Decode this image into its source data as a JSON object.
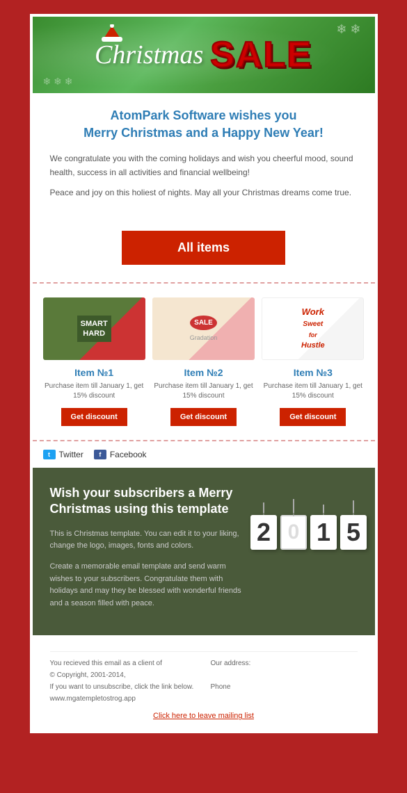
{
  "header": {
    "banner": {
      "christmas_text": "Christmas",
      "sale_text": "SALE"
    },
    "title": "AtomPark Software wishes you\nMerry Christmas and a Happy New Year!",
    "body1": "We congratulate you with the coming holidays and wish you cheerful mood, sound health, success in all activities and financial wellbeing!",
    "body2": "Peace and joy on this holiest of nights. May all your Christmas dreams come true."
  },
  "cta": {
    "button_label": "All items"
  },
  "products": {
    "items": [
      {
        "id": "1",
        "title": "Item №1",
        "description": "Purchase item till January 1, get 15% discount",
        "button_label": "Get discount",
        "img_text1": "SMART",
        "img_text2": "HARD"
      },
      {
        "id": "2",
        "title": "Item №2",
        "description": "Purchase item till January 1, get 15% discount",
        "button_label": "Get discount",
        "img_text1": "SALE",
        "img_text2": "Gradation"
      },
      {
        "id": "3",
        "title": "Item №3",
        "description": "Purchase item till January 1, get 15% discount",
        "button_label": "Get discount",
        "img_text1": "Work",
        "img_text2": "Sweet"
      }
    ]
  },
  "social": {
    "twitter_label": "Twitter",
    "facebook_label": "Facebook"
  },
  "promo": {
    "title": "Wish your subscribers a Merry Christmas using this template",
    "body1": "This is Christmas template. You can edit it to your liking, change the logo, images, fonts and colors.",
    "body2": "Create a memorable email template and send warm wishes to your subscribers. Congratulate them with holidays and may they be blessed with wonderful friends and a season filled with peace.",
    "year": "2015",
    "year_digits": [
      "2",
      "0",
      "1",
      "5"
    ]
  },
  "footer": {
    "left_line1": "You recieved this email as a client of",
    "left_line2": "© Copyright, 2001-2014,",
    "left_line3": "If you want to unsubscribe, click the link below.",
    "left_line4": "www.mgatempletostrog.app",
    "right_line1": "Our address:",
    "right_line2": "",
    "right_line3": "Phone",
    "unsubscribe_label": "Click here to leave mailing list"
  }
}
